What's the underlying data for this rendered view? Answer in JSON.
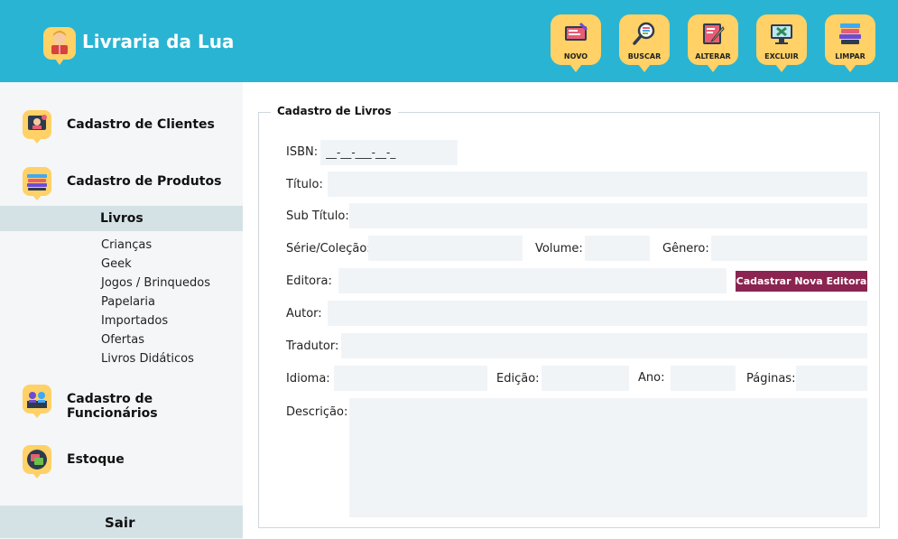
{
  "app": {
    "title": "Livraria da Lua"
  },
  "toolbar": {
    "novo": "NOVO",
    "buscar": "BUSCAR",
    "alterar": "ALTERAR",
    "excluir": "EXCLUIR",
    "limpar": "LIMPAR"
  },
  "sidebar": {
    "clientes": "Cadastro de Clientes",
    "produtos": "Cadastro de Produtos",
    "active": "Livros",
    "subitems": [
      "Crianças",
      "Geek",
      "Jogos / Brinquedos",
      "Papelaria",
      "Importados",
      "Ofertas",
      "Livros Didáticos"
    ],
    "funcionarios": "Cadastro de Funcionários",
    "estoque": "Estoque",
    "sair": "Sair"
  },
  "form": {
    "legend": "Cadastro de Livros",
    "isbn_label": "ISBN:",
    "isbn_value": "__-__-___-__-_",
    "titulo_label": "Título:",
    "subtitulo_label": "Sub Título:",
    "serie_label": "Série/Coleção:",
    "volume_label": "Volume:",
    "genero_label": "Gênero:",
    "editora_label": "Editora:",
    "nova_editora_button": "Cadastrar Nova Editora",
    "autor_label": "Autor:",
    "tradutor_label": "Tradutor:",
    "idioma_label": "Idioma:",
    "edicao_label": "Edição:",
    "ano_label": "Ano:",
    "paginas_label": "Páginas:",
    "descricao_label": "Descrição:"
  },
  "colors": {
    "header": "#2ab4d3",
    "icon_bg": "#ffd166",
    "sidebar_bg": "#f4f6f8",
    "sidebar_active": "#d4e2e6",
    "input_bg": "#f1f4f7",
    "accent_button": "#8b2450"
  }
}
